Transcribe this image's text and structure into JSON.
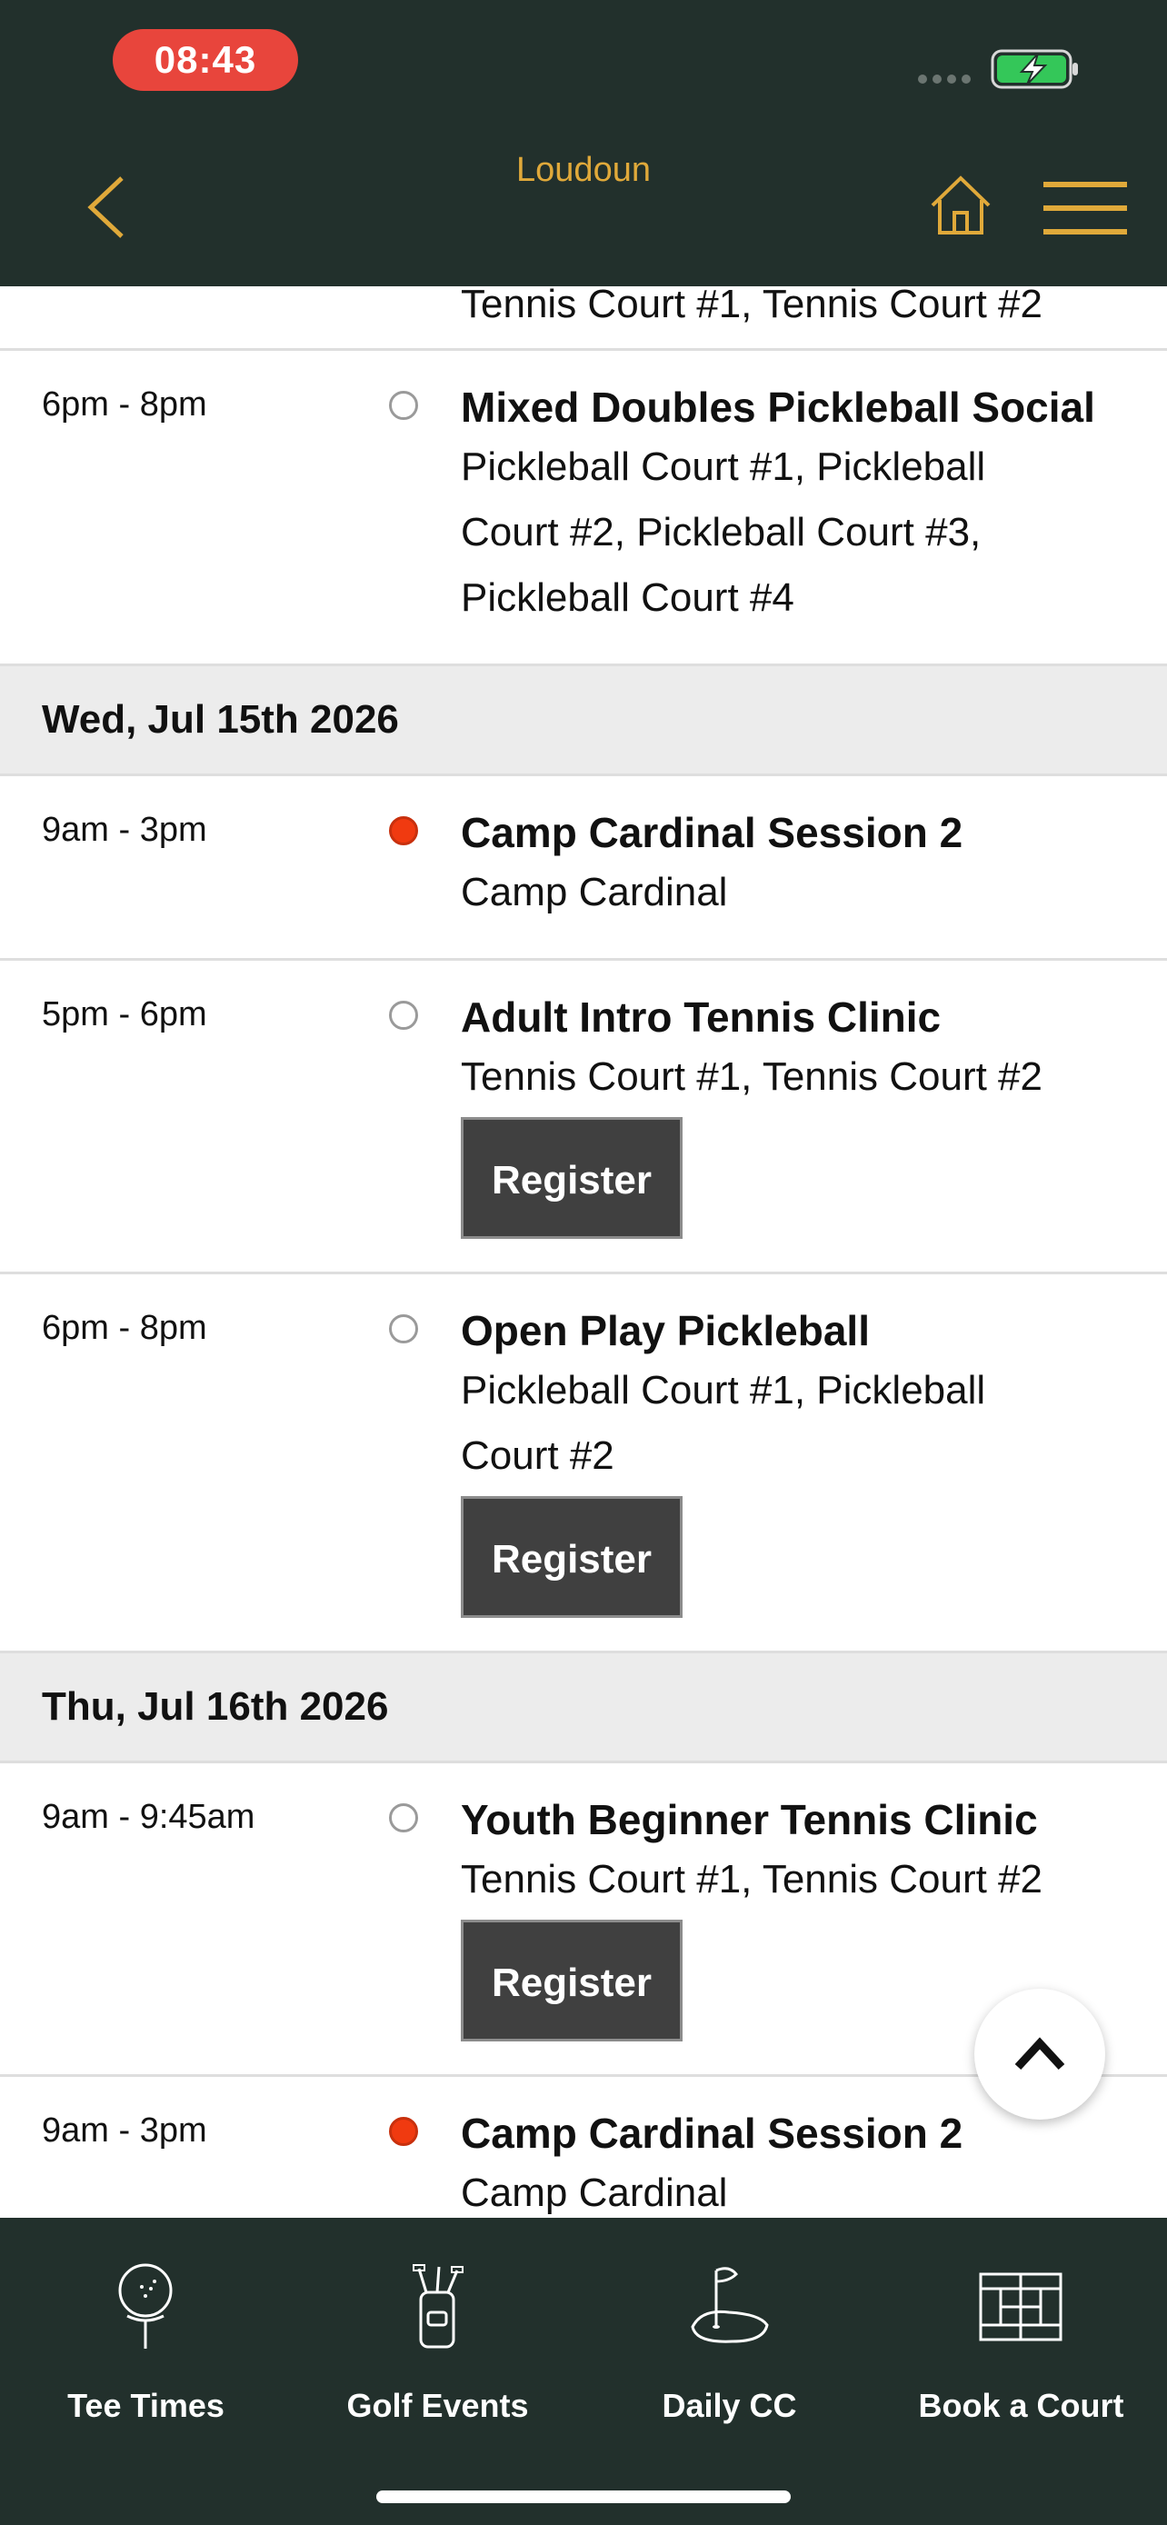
{
  "status_bar": {
    "time": "08:43"
  },
  "header": {
    "title": "Loudoun"
  },
  "partial_top_location": "Tennis Court #1, Tennis Court #2",
  "rows_block1": [
    {
      "time": "6pm - 8pm",
      "status": "empty",
      "title": "Mixed Doubles Pickleball Social",
      "location_lines": [
        "Pickleball Court #1, Pickleball",
        "Court #2, Pickleball Court #3,",
        "Pickleball Court #4"
      ]
    }
  ],
  "date1": "Wed, Jul 15th 2026",
  "rows_block2": [
    {
      "time": "9am - 3pm",
      "status": "filled",
      "title": "Camp Cardinal Session 2",
      "location_lines": [
        "Camp Cardinal"
      ]
    },
    {
      "time": "5pm - 6pm",
      "status": "empty",
      "title": "Adult Intro Tennis Clinic",
      "location_lines": [
        "Tennis Court #1, Tennis Court #2"
      ],
      "register": "Register"
    },
    {
      "time": "6pm - 8pm",
      "status": "empty",
      "title": "Open Play Pickleball",
      "location_lines": [
        "Pickleball Court #1, Pickleball",
        "Court #2"
      ],
      "register": "Register"
    }
  ],
  "date2": "Thu, Jul 16th 2026",
  "rows_block3": [
    {
      "time": "9am - 9:45am",
      "status": "empty",
      "title": "Youth Beginner Tennis Clinic",
      "location_lines": [
        "Tennis Court #1, Tennis Court #2"
      ],
      "register": "Register"
    },
    {
      "time": "9am - 3pm",
      "status": "filled",
      "title": "Camp Cardinal Session 2",
      "location_lines": [
        "Camp Cardinal"
      ]
    }
  ],
  "bottom_nav": [
    {
      "label": "Tee Times",
      "icon": "golf-ball-tee-icon"
    },
    {
      "label": "Golf Events",
      "icon": "golf-bag-icon"
    },
    {
      "label": "Daily CC",
      "icon": "golf-green-flag-icon"
    },
    {
      "label": "Book a Court",
      "icon": "court-grid-icon"
    }
  ],
  "colors": {
    "header_bg": "#22302c",
    "accent": "#e0a93a",
    "register_bg": "#404040",
    "status_dot": "#f03a10"
  }
}
